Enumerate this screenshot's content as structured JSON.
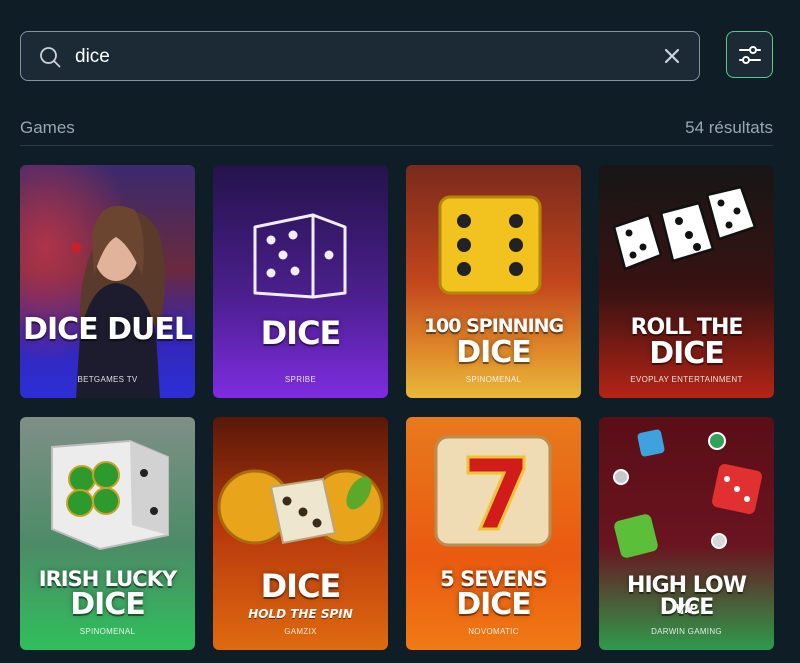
{
  "search": {
    "value": "dice",
    "placeholder": ""
  },
  "section": {
    "title": "Games",
    "count": "54 résultats"
  },
  "colors": {
    "filter_border": "#57c98a",
    "background": "#0f1d26"
  },
  "games": [
    {
      "title": "DICE DUEL",
      "subtitle": "",
      "provider": "BETGAMES TV"
    },
    {
      "title": "DICE",
      "subtitle": "",
      "provider": "SPRIBE"
    },
    {
      "title_line1": "100 SPINNING",
      "title_line2": "DICE",
      "provider": "SPINOMENAL"
    },
    {
      "title_line1": "ROLL THE",
      "title_line2": "DICE",
      "provider": "EVOPLAY ENTERTAINMENT"
    },
    {
      "title_line1": "IRISH LUCKY",
      "title_line2": "DICE",
      "provider": "SPINOMENAL"
    },
    {
      "title": "DICE",
      "subtitle": "HOLD THE SPIN",
      "provider": "GAMZIX"
    },
    {
      "title_line1": "5 SEVENS",
      "title_line2": "DICE",
      "provider": "NOVOMATIC"
    },
    {
      "title": "HIGH LOW DICE",
      "subtitle": "VIP",
      "provider": "DARWIN GAMING"
    }
  ]
}
